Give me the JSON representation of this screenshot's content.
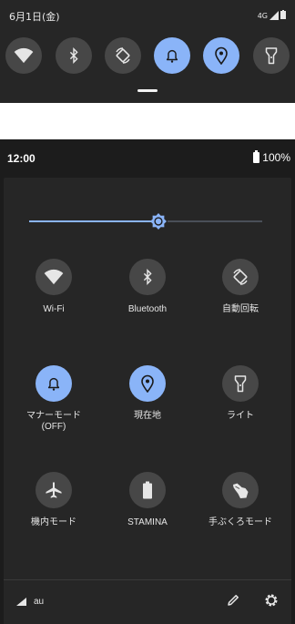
{
  "top_panel": {
    "date": "6月1日(金)",
    "network": "4G",
    "quick_icons": [
      "wifi-icon",
      "bluetooth-icon",
      "auto-rotate-icon",
      "bell-icon",
      "location-pin-icon",
      "flashlight-icon"
    ]
  },
  "expanded": {
    "time": "12:00",
    "battery": "100%",
    "brightness_level": 0.55,
    "tiles": [
      {
        "label": "Wi-Fi",
        "icon": "wifi-icon",
        "active": false
      },
      {
        "label": "Bluetooth",
        "icon": "bluetooth-icon",
        "active": false
      },
      {
        "label": "自動回転",
        "icon": "auto-rotate-icon",
        "active": false
      },
      {
        "label": "マナーモード",
        "sub": "(OFF)",
        "icon": "bell-icon",
        "active": true
      },
      {
        "label": "現在地",
        "icon": "location-pin-icon",
        "active": true
      },
      {
        "label": "ライト",
        "icon": "flashlight-icon",
        "active": false
      },
      {
        "label": "機内モード",
        "icon": "airplane-icon",
        "active": false
      },
      {
        "label": "STAMINA",
        "icon": "battery-icon",
        "active": false
      },
      {
        "label": "手ぶくろモード",
        "icon": "glove-hand-icon",
        "active": false
      }
    ],
    "footer": {
      "carrier": "au"
    }
  },
  "colors": {
    "accent": "#8ab4f8",
    "tile_off": "#474747",
    "panel": "#262626"
  }
}
